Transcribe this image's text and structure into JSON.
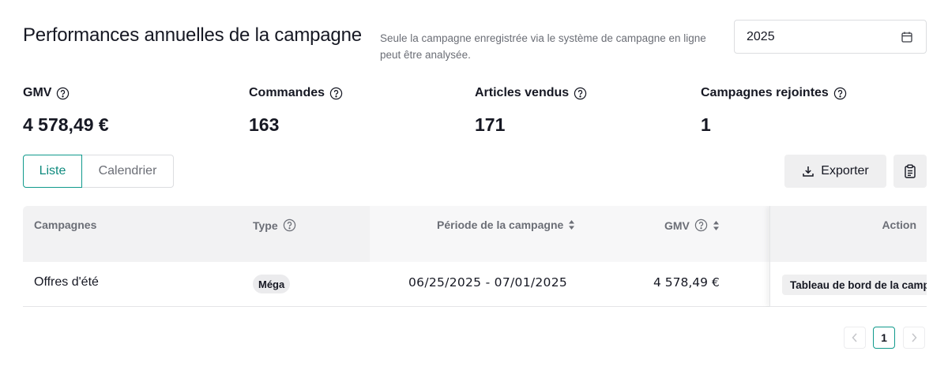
{
  "header": {
    "title": "Performances annuelles de la campagne",
    "subtitle": "Seule la campagne enregistrée via le système de campagne en ligne peut être analysée.",
    "year": "2025"
  },
  "stats": [
    {
      "label": "GMV",
      "value": "4 578,49 €"
    },
    {
      "label": "Commandes",
      "value": "163"
    },
    {
      "label": "Articles vendus",
      "value": "171"
    },
    {
      "label": "Campagnes rejointes",
      "value": "1"
    }
  ],
  "view_toggle": {
    "list": "Liste",
    "calendar": "Calendrier",
    "active": "list"
  },
  "toolbar": {
    "export_label": "Exporter"
  },
  "table": {
    "columns": [
      "Campagnes",
      "Type",
      "Période de la campagne",
      "GMV",
      "Action"
    ],
    "rows": [
      {
        "name": "Offres d'été",
        "type": "Méga",
        "period": "06/25/2025 - 07/01/2025",
        "gmv": "4 578,49 €",
        "action": "Tableau de bord de la campagne"
      }
    ]
  },
  "pagination": {
    "current": "1"
  },
  "colors": {
    "accent": "#109a8c",
    "text": "#161823",
    "muted": "#6b6e76"
  }
}
